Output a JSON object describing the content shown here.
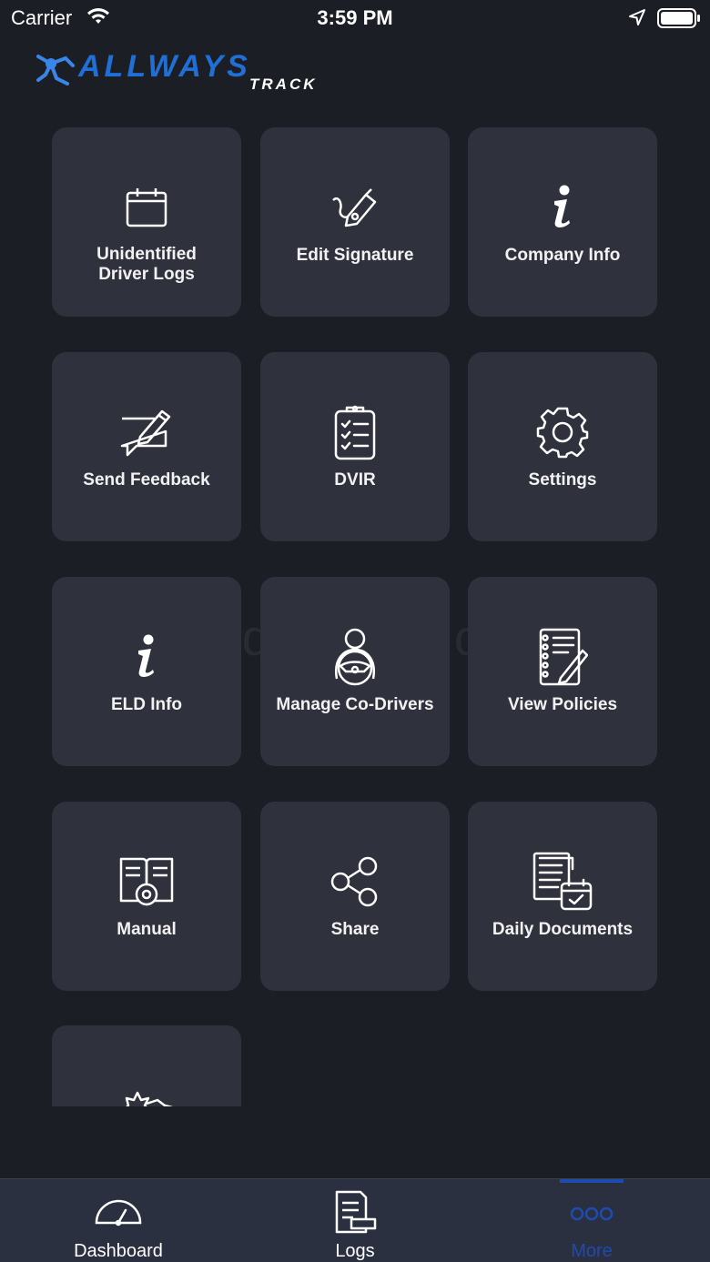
{
  "status_bar": {
    "carrier": "Carrier",
    "time": "3:59 PM"
  },
  "logo": {
    "text_main": "ALLWAYS",
    "text_sub": "TRACK",
    "brand_color": "#1f6fd6"
  },
  "menu": {
    "tiles": [
      {
        "label": "Unidentified Driver Logs",
        "icon": "calendar-icon"
      },
      {
        "label": "Edit Signature",
        "icon": "pen-nib-icon"
      },
      {
        "label": "Company Info",
        "icon": "info-icon"
      },
      {
        "label": "Send Feedback",
        "icon": "feedback-edit-icon"
      },
      {
        "label": "DVIR",
        "icon": "clipboard-checklist-icon"
      },
      {
        "label": "Settings",
        "icon": "gear-icon"
      },
      {
        "label": "ELD Info",
        "icon": "info-icon"
      },
      {
        "label": "Manage Co-Drivers",
        "icon": "driver-wheel-icon"
      },
      {
        "label": "View Policies",
        "icon": "notebook-pen-icon"
      },
      {
        "label": "Manual",
        "icon": "book-gear-icon"
      },
      {
        "label": "Share",
        "icon": "share-icon"
      },
      {
        "label": "Daily Documents",
        "icon": "documents-calendar-icon"
      },
      {
        "label": "",
        "icon": "accident-icon"
      }
    ]
  },
  "watermark": "UpdateStar.com",
  "tabbar": {
    "tabs": [
      {
        "label": "Dashboard",
        "icon": "speedometer-icon",
        "active": false
      },
      {
        "label": "Logs",
        "icon": "logs-icon",
        "active": false
      },
      {
        "label": "More",
        "icon": "more-dots-icon",
        "active": true
      }
    ],
    "active_color": "#1e4bb0"
  }
}
